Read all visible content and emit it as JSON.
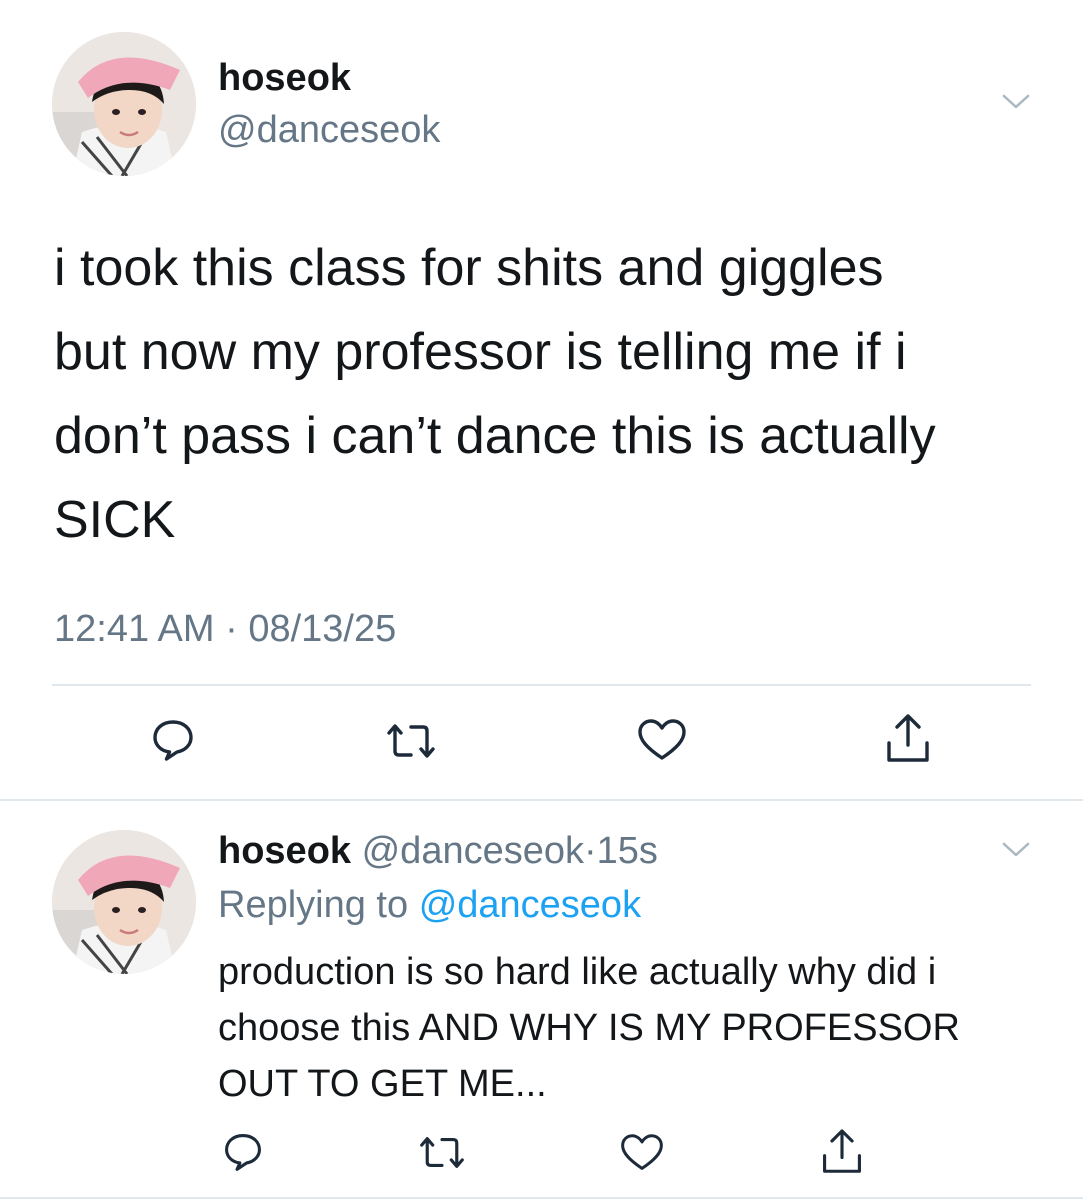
{
  "main_tweet": {
    "display_name": "hoseok",
    "handle": "@danceseok",
    "text_lines": [
      "i took this class for shits and giggles",
      "but now my professor is telling me if i",
      "don’t pass i can’t dance this is actually",
      "SICK"
    ],
    "time": "12:41 AM",
    "separator": "·",
    "date": "08/13/25"
  },
  "reply": {
    "display_name": "hoseok",
    "handle": "@danceseok",
    "separator": "·",
    "age": "15s",
    "replying_label": "Replying to",
    "replying_handle": "@danceseok",
    "text_lines": [
      "production is so hard like actually why did i",
      "choose this AND WHY IS MY PROFESSOR",
      "OUT TO GET ME..."
    ]
  },
  "icons": {
    "reply": "speech-bubble-icon",
    "retweet": "retweet-icon",
    "like": "heart-icon",
    "share": "share-icon",
    "more": "chevron-down-icon"
  },
  "colors": {
    "text": "#14171a",
    "muted": "#657786",
    "link": "#1da1f2",
    "divider": "#e1e8ed"
  }
}
